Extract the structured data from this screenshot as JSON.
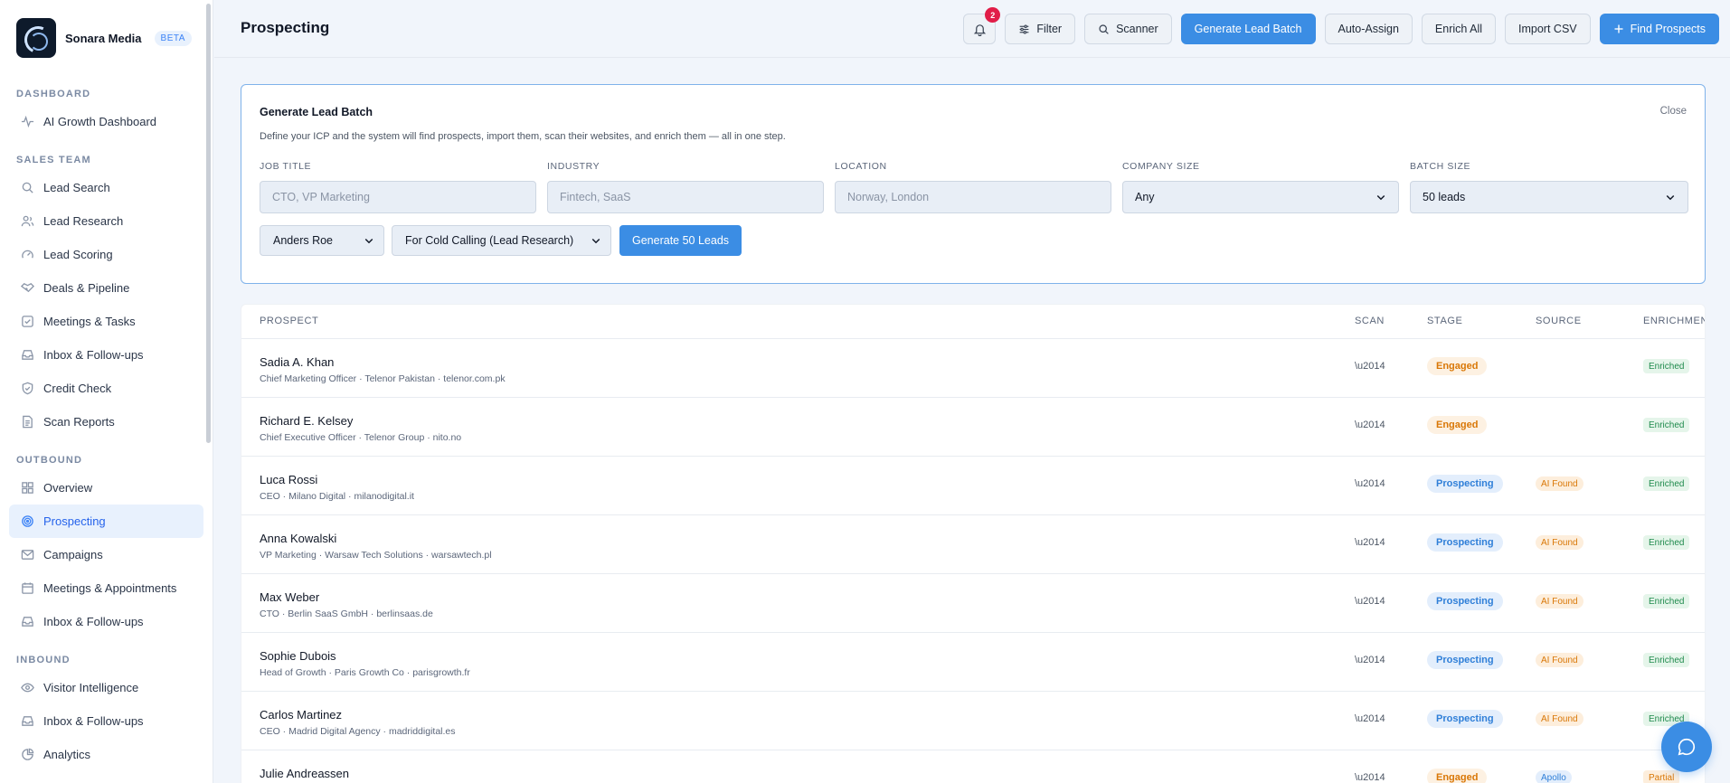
{
  "brand": {
    "name": "Sonara Media",
    "badge": "BETA"
  },
  "sidebar": {
    "sections": [
      {
        "label": "DASHBOARD",
        "items": [
          {
            "label": "AI Growth Dashboard",
            "icon": "pulse-icon"
          }
        ]
      },
      {
        "label": "SALES TEAM",
        "items": [
          {
            "label": "Lead Search",
            "icon": "search-icon"
          },
          {
            "label": "Lead Research",
            "icon": "users-icon"
          },
          {
            "label": "Lead Scoring",
            "icon": "gauge-icon"
          },
          {
            "label": "Deals & Pipeline",
            "icon": "handshake-icon"
          },
          {
            "label": "Meetings & Tasks",
            "icon": "checkbox-icon"
          },
          {
            "label": "Inbox & Follow-ups",
            "icon": "inbox-icon"
          },
          {
            "label": "Credit Check",
            "icon": "shield-check-icon"
          },
          {
            "label": "Scan Reports",
            "icon": "document-icon"
          }
        ]
      },
      {
        "label": "OUTBOUND",
        "items": [
          {
            "label": "Overview",
            "icon": "grid-icon"
          },
          {
            "label": "Prospecting",
            "icon": "target-icon",
            "active": true
          },
          {
            "label": "Campaigns",
            "icon": "mail-icon"
          },
          {
            "label": "Meetings & Appointments",
            "icon": "calendar-icon"
          },
          {
            "label": "Inbox & Follow-ups",
            "icon": "inbox-icon"
          }
        ]
      },
      {
        "label": "INBOUND",
        "items": [
          {
            "label": "Visitor Intelligence",
            "icon": "eye-icon"
          },
          {
            "label": "Inbox & Follow-ups",
            "icon": "inbox-icon"
          },
          {
            "label": "Analytics",
            "icon": "pie-chart-icon"
          }
        ]
      }
    ]
  },
  "header": {
    "title": "Prospecting",
    "notifications": "2",
    "buttons": {
      "filter": "Filter",
      "scanner": "Scanner",
      "generate": "Generate Lead Batch",
      "auto_assign": "Auto-Assign",
      "enrich_all": "Enrich All",
      "import_csv": "Import CSV",
      "find_prospects": "Find Prospects"
    }
  },
  "panel": {
    "title": "Generate Lead Batch",
    "close": "Close",
    "description": "Define your ICP and the system will find prospects, import them, scan their websites, and enrich them — all in one step.",
    "fields": {
      "job_title": {
        "label": "JOB TITLE",
        "placeholder": "CTO, VP Marketing"
      },
      "industry": {
        "label": "INDUSTRY",
        "placeholder": "Fintech, SaaS"
      },
      "location": {
        "label": "LOCATION",
        "placeholder": "Norway, London"
      },
      "company_size": {
        "label": "COMPANY SIZE",
        "value": "Any"
      },
      "batch_size": {
        "label": "BATCH SIZE",
        "value": "50 leads"
      }
    },
    "assignee": "Anders Roe",
    "purpose": "For Cold Calling (Lead Research)",
    "generate_button": "Generate 50 Leads"
  },
  "table": {
    "headers": {
      "prospect": "PROSPECT",
      "scan": "SCAN",
      "stage": "STAGE",
      "source": "SOURCE",
      "enrichment": "ENRICHMEN"
    },
    "rows": [
      {
        "name": "Sadia A. Khan",
        "meta": "Chief Marketing Officer · Telenor Pakistan · telenor.com.pk",
        "scan": "\\u2014",
        "stage": "Engaged",
        "source": "",
        "enrichment": "Enriched"
      },
      {
        "name": "Richard E. Kelsey",
        "meta": "Chief Executive Officer · Telenor Group · nito.no",
        "scan": "\\u2014",
        "stage": "Engaged",
        "source": "",
        "enrichment": "Enriched"
      },
      {
        "name": "Luca Rossi",
        "meta": "CEO · Milano Digital · milanodigital.it",
        "scan": "\\u2014",
        "stage": "Prospecting",
        "source": "AI Found",
        "enrichment": "Enriched"
      },
      {
        "name": "Anna Kowalski",
        "meta": "VP Marketing · Warsaw Tech Solutions · warsawtech.pl",
        "scan": "\\u2014",
        "stage": "Prospecting",
        "source": "AI Found",
        "enrichment": "Enriched"
      },
      {
        "name": "Max Weber",
        "meta": "CTO · Berlin SaaS GmbH · berlinsaas.de",
        "scan": "\\u2014",
        "stage": "Prospecting",
        "source": "AI Found",
        "enrichment": "Enriched"
      },
      {
        "name": "Sophie Dubois",
        "meta": "Head of Growth · Paris Growth Co · parisgrowth.fr",
        "scan": "\\u2014",
        "stage": "Prospecting",
        "source": "AI Found",
        "enrichment": "Enriched"
      },
      {
        "name": "Carlos Martinez",
        "meta": "CEO · Madrid Digital Agency · madriddigital.es",
        "scan": "\\u2014",
        "stage": "Prospecting",
        "source": "AI Found",
        "enrichment": "Enriched"
      },
      {
        "name": "Julie Andreassen",
        "meta": "",
        "scan": "\\u2014",
        "stage": "Engaged",
        "source": "Apollo",
        "enrichment": "Partial"
      }
    ]
  },
  "colors": {
    "accent": "#3b8de4",
    "engaged": "#d97706",
    "prospecting": "#2f7fd8",
    "enriched": "#1f8a4c"
  }
}
